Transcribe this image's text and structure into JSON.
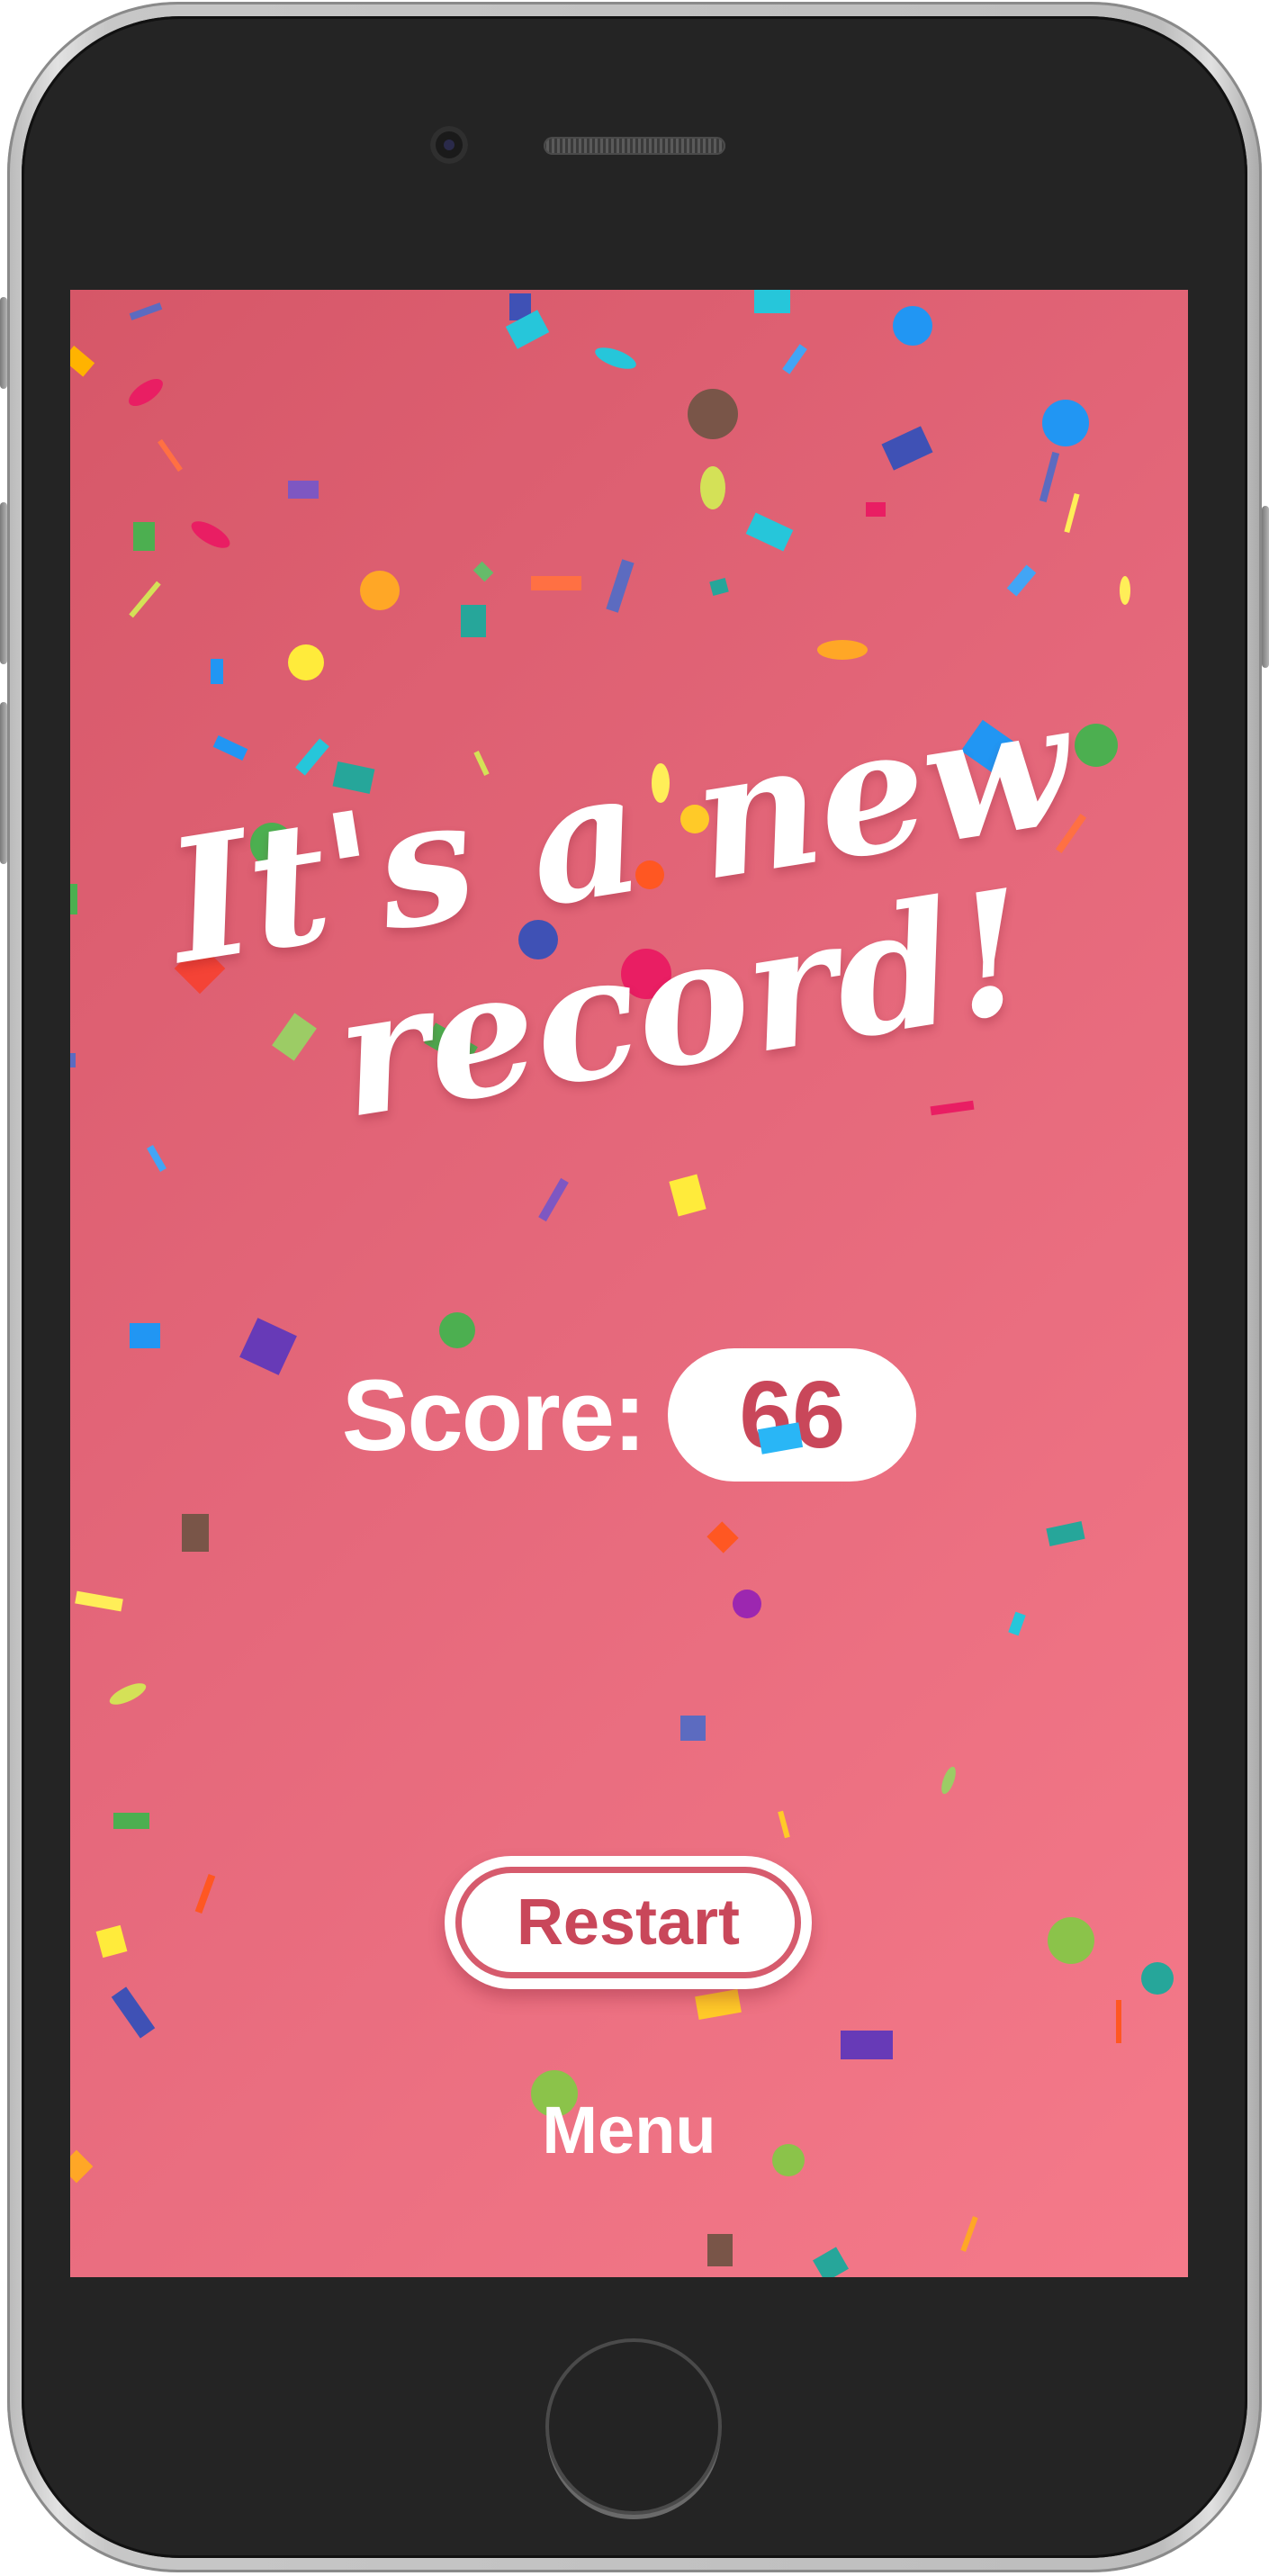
{
  "device": {
    "frame_color": "#242424",
    "bezel_color": "#c4c4c4"
  },
  "screen": {
    "gradient_start": "#d65768",
    "gradient_end": "#f57a8a"
  },
  "celebration": {
    "title_line1": "It's a new",
    "title_line2": "record!"
  },
  "score": {
    "label": "Score:",
    "value": "66"
  },
  "actions": {
    "restart_label": "Restart",
    "menu_label": "Menu"
  },
  "colors": {
    "accent": "#c9475a",
    "text_light": "#ffffff"
  },
  "icons": {
    "home_button": "home-button-icon",
    "camera": "front-camera-icon",
    "speaker": "earpiece-speaker-icon"
  }
}
